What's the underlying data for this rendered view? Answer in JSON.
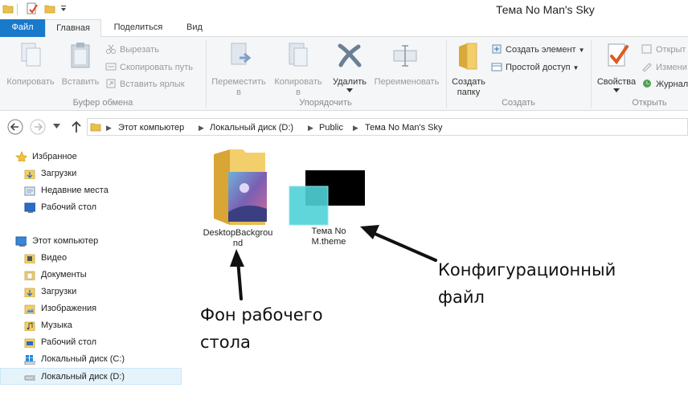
{
  "window": {
    "title": "Тема No Man's Sky"
  },
  "tabs": {
    "file": "Файл",
    "home": "Главная",
    "share": "Поделиться",
    "view": "Вид"
  },
  "ribbon": {
    "clipboard": {
      "label": "Буфер обмена",
      "copy": "Копировать",
      "paste": "Вставить",
      "cut": "Вырезать",
      "copy_path": "Скопировать путь",
      "paste_shortcut": "Вставить ярлык"
    },
    "organize": {
      "label": "Упорядочить",
      "move_line1": "Переместить",
      "move_line2": "в",
      "copyto_line1": "Копировать",
      "copyto_line2": "в",
      "delete": "Удалить",
      "rename": "Переименовать"
    },
    "create": {
      "label": "Создать",
      "new_folder_line1": "Создать",
      "new_folder_line2": "папку",
      "new_item": "Создать элемент",
      "easy_access": "Простой доступ"
    },
    "open": {
      "label": "Открыть",
      "properties": "Свойства",
      "open": "Открыт",
      "edit": "Измени",
      "history": "Журнал"
    }
  },
  "address": {
    "crumbs": [
      "Этот компьютер",
      "Локальный диск (D:)",
      "Public",
      "Тема No Man's Sky"
    ]
  },
  "nav": {
    "favorites": "Избранное",
    "fav_downloads": "Загрузки",
    "fav_recent": "Недавние места",
    "fav_desktop": "Рабочий стол",
    "this_pc": "Этот компьютер",
    "videos": "Видео",
    "documents": "Документы",
    "downloads": "Загрузки",
    "pictures": "Изображения",
    "music": "Музыка",
    "desktop": "Рабочий стол",
    "disk_c": "Локальный диск (C:)",
    "disk_d": "Локальный диск (D:)"
  },
  "files": {
    "folder_line1": "DesktopBackgrou",
    "folder_line2": "nd",
    "theme_line1": "Тема No",
    "theme_line2": "M.theme"
  },
  "annotations": {
    "config_line1": "Конфигурационный",
    "config_line2": "файл",
    "bg_line1": "Фон рабочего",
    "bg_line2": "стола"
  },
  "colors": {
    "file_tab": "#1979ca",
    "ribbon_bg": "#f5f6f7",
    "folder_yellow": "#f2cf6b",
    "theme_cyan": "#4fd1d7",
    "selection": "#e5f3fb"
  }
}
